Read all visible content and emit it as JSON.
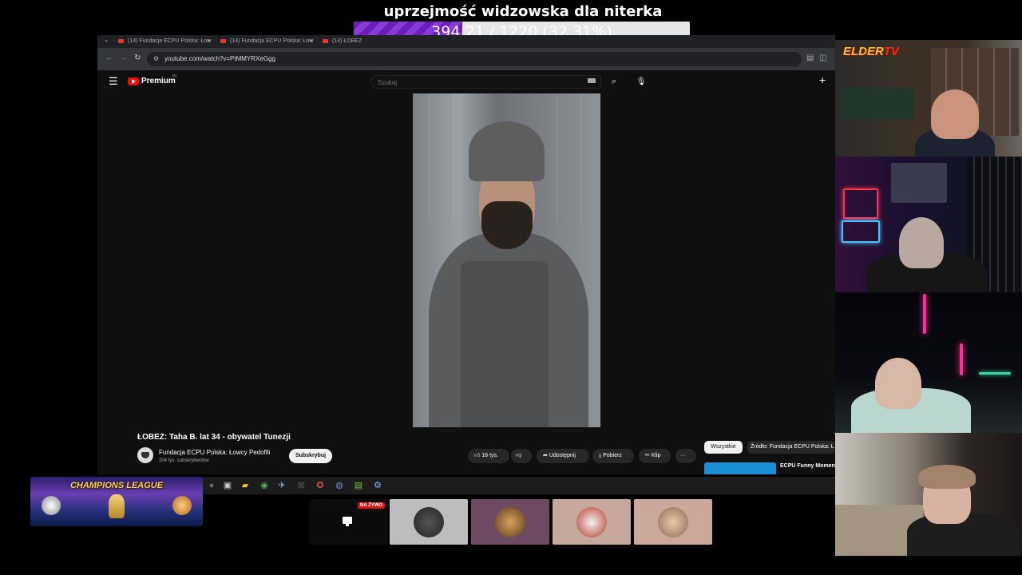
{
  "overlay": {
    "title": "uprzejmość widzowska dla niterka",
    "goal_text": "394.21 / 1220 (32.31%)",
    "goal_progress": 0.3231,
    "fill_color": "#7a2fc6"
  },
  "browser": {
    "tabs": [
      {
        "label": "(14) Fundacja ECPU Polska: Łow"
      },
      {
        "label": "(14) Fundacja ECPU Polska: Łow"
      },
      {
        "label": "(14) ŁOBEZ"
      }
    ],
    "url": "youtube.com/watch?v=PtMMYRXeGgg"
  },
  "youtube": {
    "brand": "Premium",
    "country": "PL",
    "search_placeholder": "Szukaj",
    "video_title": "ŁOBEZ: Taha B. lat 34 - obywatel Tunezji",
    "channel_name": "Fundacja ECPU Polska: Łowcy Pedofili",
    "channel_subs": "204 tys. subskrybentów",
    "subscribe_label": "Subskrybuj",
    "likes": "18 tys.",
    "share_label": "Udostępnij",
    "download_label": "Pobierz",
    "clip_label": "Klip",
    "more_label": "···",
    "chip_all": "Wszystkie",
    "chip_source": "Źródło: Fundacja ECPU Polska: Ł",
    "related_title": "ECPU Funny Moment"
  },
  "stream": {
    "elder_logo_a": "ELDER",
    "elder_logo_b": "TV",
    "champions_league": "CHAMPIONS LEAGUE",
    "live_badge": "NA ŻYWO"
  },
  "icons": {
    "menu": "menu-icon",
    "search": "search-icon",
    "mic": "mic-icon",
    "create": "plus-icon",
    "like": "thumb-up-icon",
    "dislike": "thumb-down-icon",
    "share": "share-icon",
    "download": "download-icon",
    "clip": "scissors-icon"
  }
}
